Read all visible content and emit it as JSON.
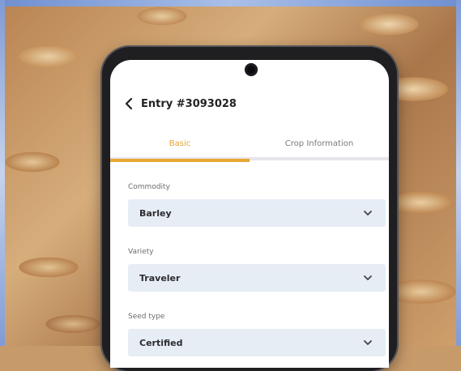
{
  "screen": {
    "title": "Entry #3093028",
    "tabs": [
      {
        "label": "Basic",
        "active": true
      },
      {
        "label": "Crop Information",
        "active": false
      }
    ]
  },
  "fields": [
    {
      "label": "Commodity",
      "value": "Barley"
    },
    {
      "label": "Variety",
      "value": "Traveler"
    },
    {
      "label": "Seed type",
      "value": "Certified"
    }
  ],
  "colors": {
    "accent": "#e8a733",
    "field_bg": "#e7edf5"
  },
  "icons": {
    "back": "chevron-left-icon",
    "dropdown": "chevron-down-icon"
  }
}
